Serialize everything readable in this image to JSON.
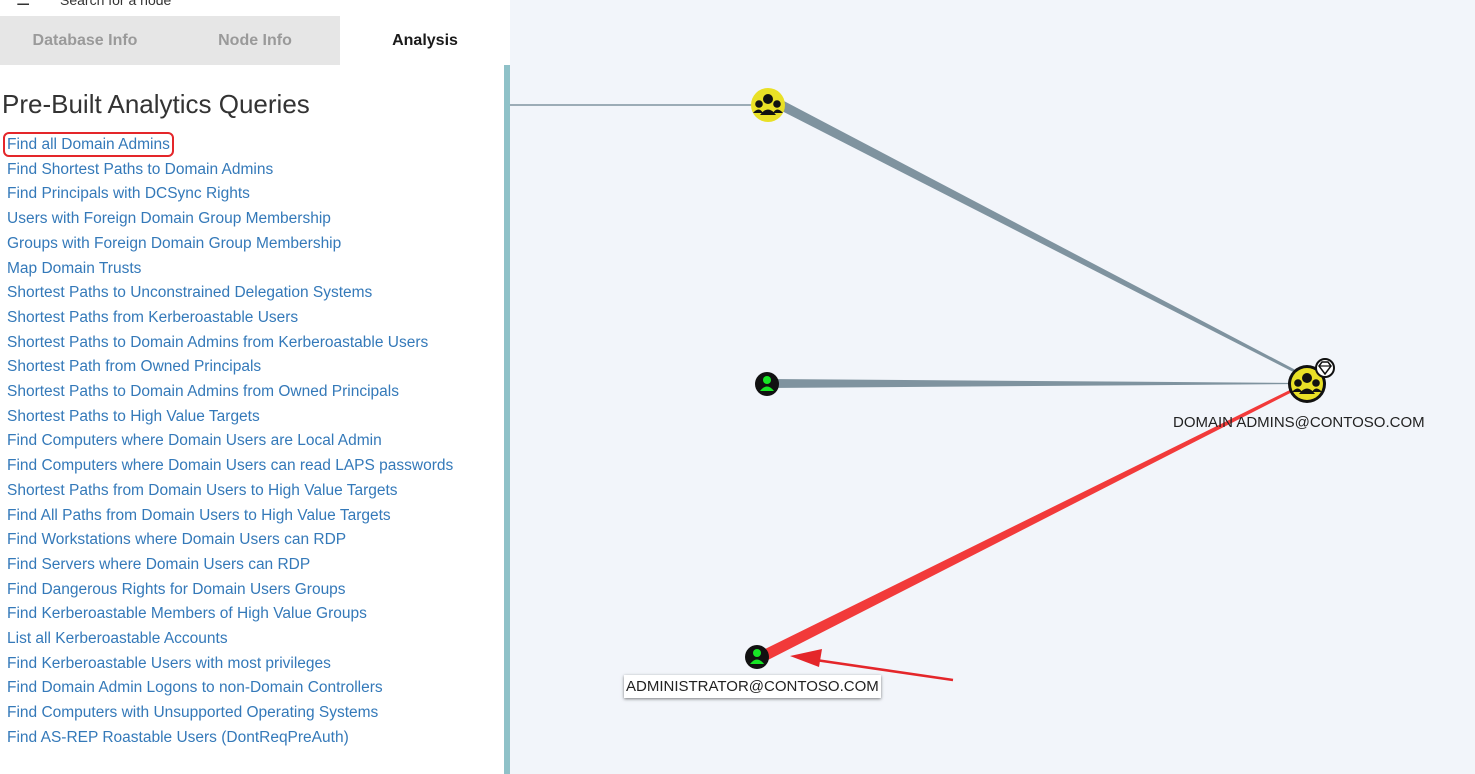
{
  "sidebar": {
    "search_placeholder": "Search for a node",
    "tabs": [
      {
        "label": "Database Info",
        "active": false
      },
      {
        "label": "Node Info",
        "active": false
      },
      {
        "label": "Analysis",
        "active": true
      }
    ],
    "heading": "Pre-Built Analytics Queries",
    "queries": [
      "Find all Domain Admins",
      "Find Shortest Paths to Domain Admins",
      "Find Principals with DCSync Rights",
      "Users with Foreign Domain Group Membership",
      "Groups with Foreign Domain Group Membership",
      "Map Domain Trusts",
      "Shortest Paths to Unconstrained Delegation Systems",
      "Shortest Paths from Kerberoastable Users",
      "Shortest Paths to Domain Admins from Kerberoastable Users",
      "Shortest Path from Owned Principals",
      "Shortest Paths to Domain Admins from Owned Principals",
      "Shortest Paths to High Value Targets",
      "Find Computers where Domain Users are Local Admin",
      "Find Computers where Domain Users can read LAPS passwords",
      "Shortest Paths from Domain Users to High Value Targets",
      "Find All Paths from Domain Users to High Value Targets",
      "Find Workstations where Domain Users can RDP",
      "Find Servers where Domain Users can RDP",
      "Find Dangerous Rights for Domain Users Groups",
      "Find Kerberoastable Members of High Value Groups",
      "List all Kerberoastable Accounts",
      "Find Kerberoastable Users with most privileges",
      "Find Domain Admin Logons to non-Domain Controllers",
      "Find Computers with Unsupported Operating Systems",
      "Find AS-REP Roastable Users (DontReqPreAuth)"
    ]
  },
  "graph": {
    "labels": {
      "domain_admins": "DOMAIN ADMINS@CONTOSO.COM",
      "administrator": "ADMINISTRATOR@CONTOSO.COM"
    }
  },
  "colors": {
    "group_node": "#e9e026",
    "user_node": "#17e625",
    "edge": "#7f939f",
    "highlight_edge": "#f23a3a",
    "annotation": "#e4262a",
    "link": "#3479b9"
  }
}
